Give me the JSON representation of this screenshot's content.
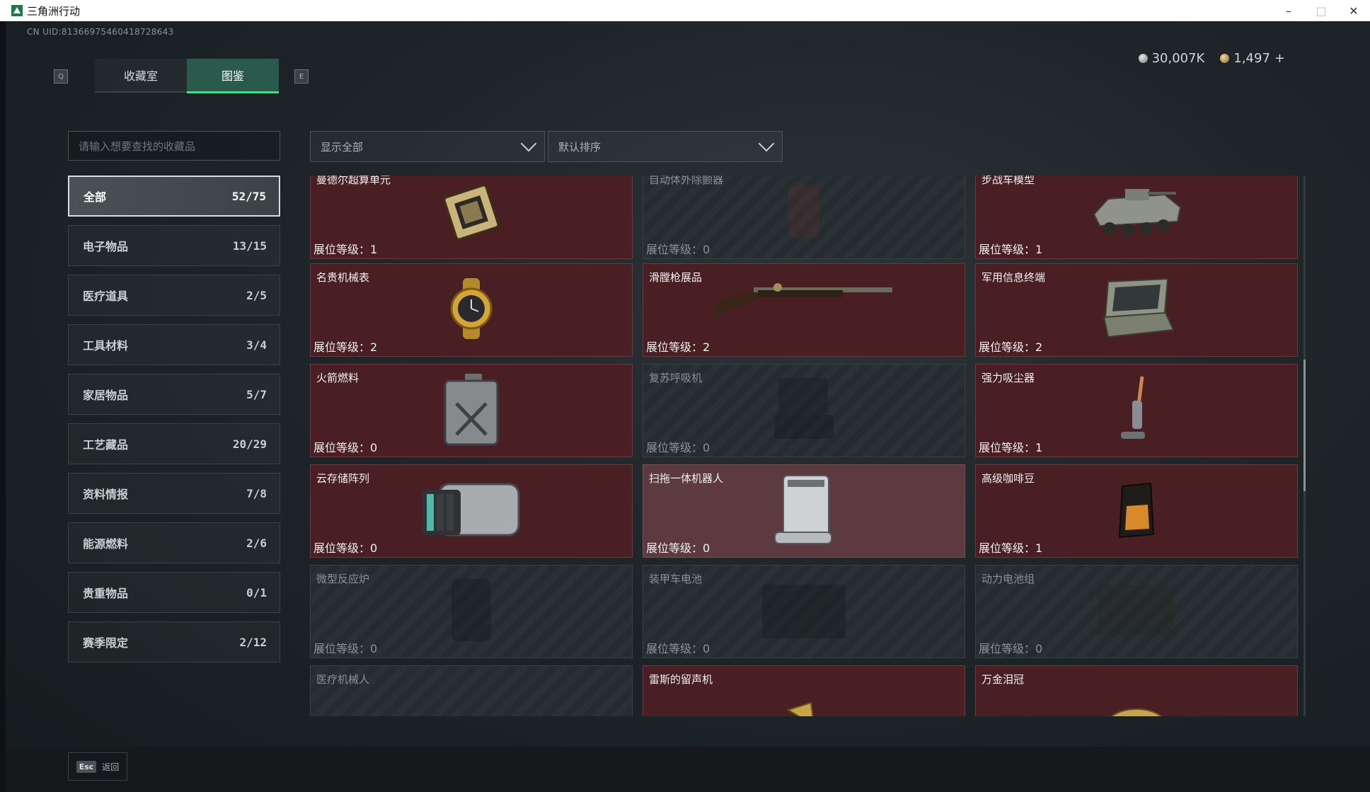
{
  "window": {
    "title": "三角洲行动"
  },
  "header": {
    "uid": "CN UID:813669754604187286​43",
    "silver": "30,007K",
    "gold": "1,497",
    "gold_plus": "+",
    "key_left": "Q",
    "key_right": "E",
    "tabs": [
      {
        "label": "收藏室"
      },
      {
        "label": "图鉴"
      }
    ]
  },
  "search": {
    "placeholder": "请输入想要查找的收藏品"
  },
  "filters": {
    "show": "显示全部",
    "sort": "默认排序"
  },
  "categories": [
    {
      "label": "全部",
      "count": "52/75"
    },
    {
      "label": "电子物品",
      "count": "13/15"
    },
    {
      "label": "医疗道具",
      "count": "2/5"
    },
    {
      "label": "工具材料",
      "count": "3/4"
    },
    {
      "label": "家居物品",
      "count": "5/7"
    },
    {
      "label": "工艺藏品",
      "count": "20/29"
    },
    {
      "label": "资料情报",
      "count": "7/8"
    },
    {
      "label": "能源燃料",
      "count": "2/6"
    },
    {
      "label": "贵重物品",
      "count": "0/1"
    },
    {
      "label": "赛季限定",
      "count": "2/12"
    }
  ],
  "items": [
    {
      "name": "曼德尔超算单元",
      "level": "展位等级：1"
    },
    {
      "name": "自动体外除颤器",
      "level": "展位等级：0"
    },
    {
      "name": "步战车模型",
      "level": "展位等级：1"
    },
    {
      "name": "名贵机械表",
      "level": "展位等级：2"
    },
    {
      "name": "滑膛枪展品",
      "level": "展位等级：2"
    },
    {
      "name": "军用信息终端",
      "level": "展位等级：2"
    },
    {
      "name": "火箭燃料",
      "level": "展位等级：0"
    },
    {
      "name": "复苏呼吸机",
      "level": "展位等级：0"
    },
    {
      "name": "强力吸尘器",
      "level": "展位等级：1"
    },
    {
      "name": "云存储阵列",
      "level": "展位等级：0"
    },
    {
      "name": "扫拖一体机器人",
      "level": "展位等级：0"
    },
    {
      "name": "高级咖啡豆",
      "level": "展位等级：1"
    },
    {
      "name": "微型反应炉",
      "level": "展位等级：0"
    },
    {
      "name": "装甲车电池",
      "level": "展位等级：0"
    },
    {
      "name": "动力电池组",
      "level": "展位等级：0"
    },
    {
      "name": "医疗机械人",
      "level": ""
    },
    {
      "name": "雷斯的留声机",
      "level": ""
    },
    {
      "name": "万金泪冠",
      "level": ""
    }
  ],
  "footer": {
    "esc_key": "Esc",
    "back": "返回"
  }
}
